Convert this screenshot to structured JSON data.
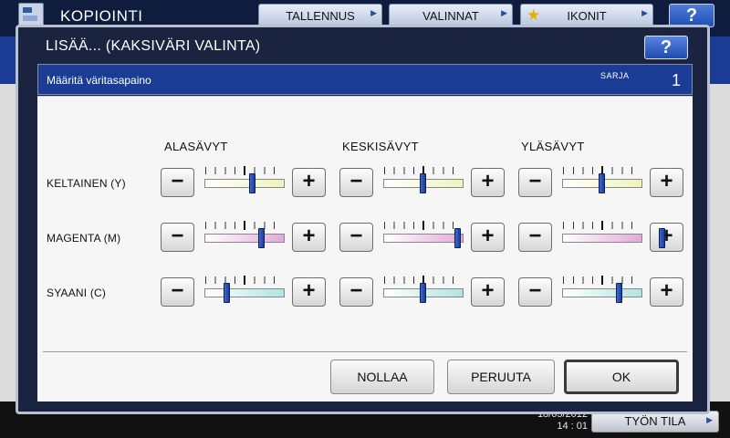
{
  "app": {
    "title": "KOPIOINTI",
    "tabs": [
      {
        "label": "TALLENNUS"
      },
      {
        "label": "VALINNAT"
      },
      {
        "label": "IKONIT"
      }
    ],
    "help": "?",
    "footer": {
      "date": "18/05/2012",
      "time": "14 : 01",
      "job_status": "TYÖN TILA"
    }
  },
  "dialog": {
    "title": "LISÄÄ... (KAKSIVÄRI VALINTA)",
    "help": "?",
    "header_label": "Määritä väritasapaino",
    "sets_label": "SARJA",
    "sets_value": "1",
    "columns": [
      "ALASÄVYT",
      "KESKISÄVYT",
      "YLÄSÄVYT"
    ],
    "minus_symbol": "−",
    "plus_symbol": "+",
    "rows": [
      {
        "label": "KELTAINEN (Y)",
        "color": "#f0f3bb",
        "levels": [
          1,
          0,
          0
        ]
      },
      {
        "label": "MAGENTA (M)",
        "color": "#e3a9da",
        "levels": [
          2,
          4,
          7
        ]
      },
      {
        "label": "SYAANI (C)",
        "color": "#b0e3e3",
        "levels": [
          -2,
          0,
          2
        ]
      }
    ],
    "slider_range": [
      -4,
      4
    ],
    "buttons": {
      "reset": "NOLLAA",
      "cancel": "PERUUTA",
      "ok": "OK"
    }
  }
}
